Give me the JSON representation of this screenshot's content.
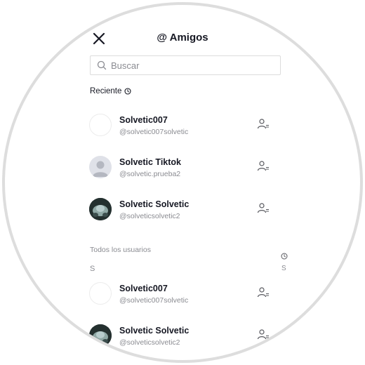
{
  "header": {
    "title": "@ Amigos"
  },
  "search": {
    "placeholder": "Buscar"
  },
  "recent": {
    "label": "Reciente",
    "users": [
      {
        "name": "Solvetic007",
        "handle": "@solvetic007solvetic",
        "avatar": "blank"
      },
      {
        "name": "Solvetic Tiktok",
        "handle": "@solvetic.prueba2",
        "avatar": "default-person"
      },
      {
        "name": "Solvetic Solvetic",
        "handle": "@solveticsolvetic2",
        "avatar": "photo"
      }
    ]
  },
  "all_users": {
    "label": "Todos los usuarios",
    "letter_header": "S",
    "users": [
      {
        "name": "Solvetic007",
        "handle": "@solvetic007solvetic",
        "avatar": "blank"
      },
      {
        "name": "Solvetic Solvetic",
        "handle": "@solveticsolvetic2",
        "avatar": "photo"
      }
    ]
  },
  "alphabet_index": {
    "letter": "S",
    "icon": "clock-icon"
  },
  "colors": {
    "text_primary": "#161823",
    "text_secondary": "#8a8b91",
    "border": "#dcdcdc",
    "frame": "#dddddd"
  }
}
